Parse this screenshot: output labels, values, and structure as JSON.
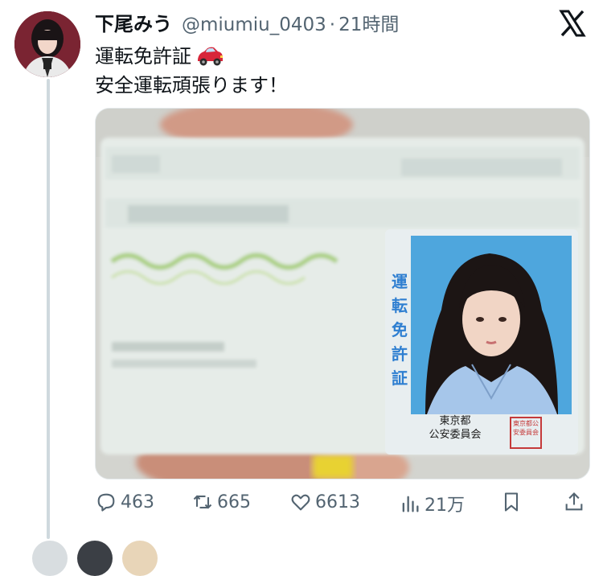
{
  "tweet": {
    "author_name": "下尾みう",
    "handle": "@miumiu_0403",
    "separator": "·",
    "timestamp": "21時間",
    "text_line1": "運転免許証",
    "text_line2": "安全運転頑張ります！"
  },
  "license_card": {
    "vertical_label": [
      "運",
      "転",
      "免",
      "許",
      "証"
    ],
    "issuer_line1": "東京都",
    "issuer_line2": "公安委員会",
    "seal_text": "東京都公安委員会"
  },
  "actions": {
    "replies": "463",
    "retweets": "665",
    "likes": "6613",
    "views": "21万"
  },
  "icons": {
    "logo": "x-logo-icon",
    "reply": "reply-icon",
    "retweet": "retweet-icon",
    "like": "heart-icon",
    "views": "views-icon",
    "bookmark": "bookmark-icon",
    "share": "share-icon",
    "emoji": "car-emoji-icon"
  },
  "colors": {
    "text": "#0f1419",
    "secondary": "#536471",
    "card_blue": "#2f7fd1",
    "card_photo_bg": "#4fa6dd"
  }
}
